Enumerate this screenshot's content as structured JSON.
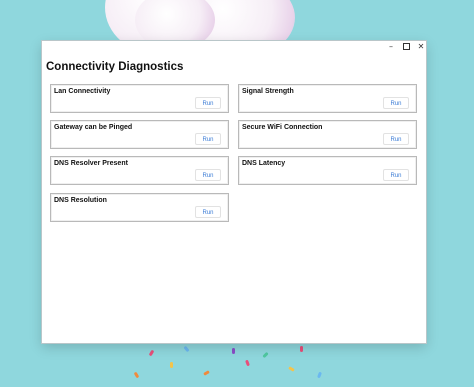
{
  "window": {
    "title": "Connectivity Diagnostics",
    "controls": {
      "minimize": "–",
      "maximize": "",
      "close": "✕"
    }
  },
  "tests": [
    {
      "label": "Lan Connectivity",
      "button": "Run"
    },
    {
      "label": "Signal Strength",
      "button": "Run"
    },
    {
      "label": "Gateway can be Pinged",
      "button": "Run"
    },
    {
      "label": "Secure WiFi Connection",
      "button": "Run"
    },
    {
      "label": "DNS Resolver Present",
      "button": "Run"
    },
    {
      "label": "DNS Latency",
      "button": "Run"
    },
    {
      "label": "DNS Resolution",
      "button": "Run"
    }
  ],
  "icons": {
    "minimize": "minimize-icon",
    "maximize": "maximize-icon",
    "close": "close-icon"
  },
  "colors": {
    "desktop": "#8fd7dd",
    "run_text": "#3a7bd5",
    "card_border": "#b9b9b9"
  }
}
